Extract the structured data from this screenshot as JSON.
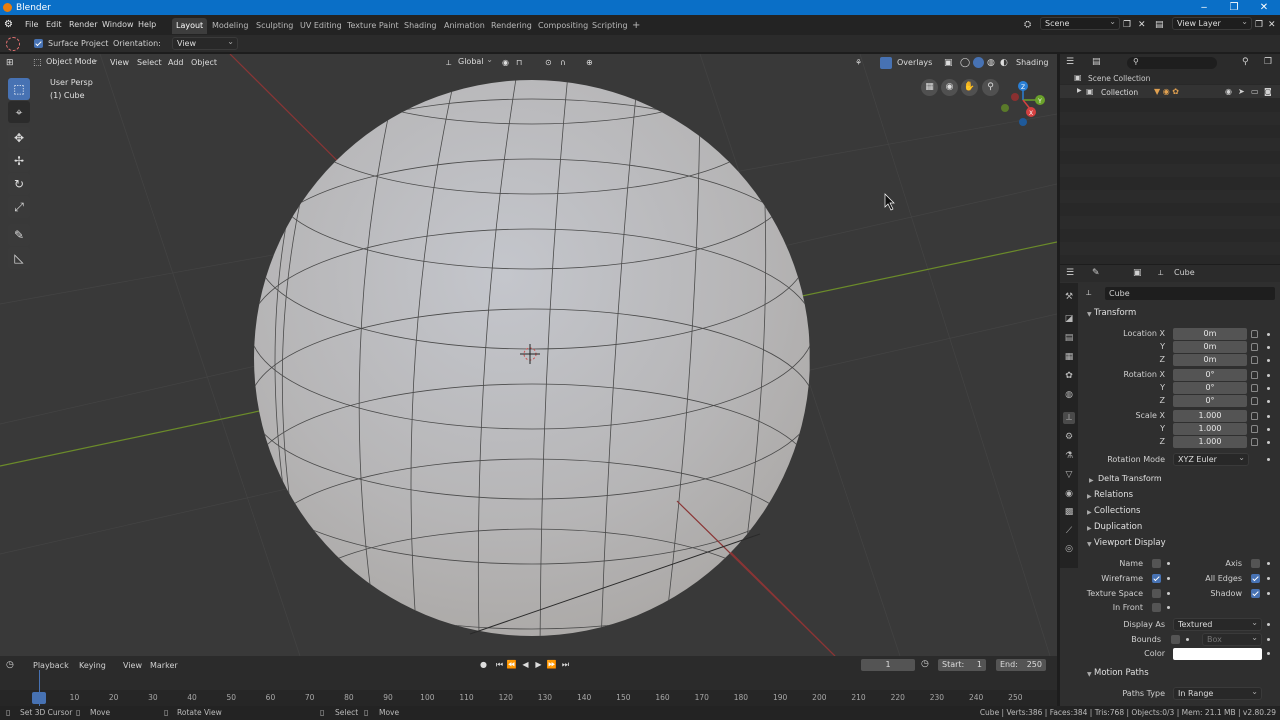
{
  "window": {
    "title": "Blender",
    "min": "‒",
    "restore": "❐",
    "close": "✕"
  },
  "menu": {
    "items": [
      "File",
      "Edit",
      "Render",
      "Window",
      "Help"
    ]
  },
  "workspaces": {
    "tabs": [
      "Layout",
      "Modeling",
      "Sculpting",
      "UV Editing",
      "Texture Paint",
      "Shading",
      "Animation",
      "Rendering",
      "Compositing",
      "Scripting"
    ],
    "active": "Layout",
    "add": "+"
  },
  "scene": {
    "name": "Scene",
    "view_layer": "View Layer"
  },
  "tool_header": {
    "surface_project": "Surface Project",
    "orientation_label": "Orientation:",
    "orientation_value": "View"
  },
  "viewport": {
    "mode": "Object Mode",
    "menus": [
      "View",
      "Select",
      "Add",
      "Object"
    ],
    "transform_orientation": "Global",
    "overlays": "Overlays",
    "shading": "Shading",
    "view_name": "User Persp",
    "object_name": "(1) Cube",
    "gizmo": {
      "x": "X",
      "y": "Y",
      "z": "Z"
    }
  },
  "outliner": {
    "search_placeholder": "",
    "scene_collection": "Scene Collection",
    "collection": "Collection"
  },
  "properties": {
    "object_name": "Cube",
    "header_name": "Cube",
    "transform": {
      "title": "Transform",
      "location": {
        "label_x": "Location X",
        "label_y": "Y",
        "label_z": "Z",
        "x": "0m",
        "y": "0m",
        "z": "0m"
      },
      "rotation": {
        "label_x": "Rotation X",
        "label_y": "Y",
        "label_z": "Z",
        "x": "0°",
        "y": "0°",
        "z": "0°"
      },
      "scale": {
        "label_x": "Scale X",
        "label_y": "Y",
        "label_z": "Z",
        "x": "1.000",
        "y": "1.000",
        "z": "1.000"
      },
      "rotation_mode_label": "Rotation Mode",
      "rotation_mode": "XYZ Euler"
    },
    "delta_transform": "Delta Transform",
    "relations": "Relations",
    "collections": "Collections",
    "duplication": "Duplication",
    "viewport_display": {
      "title": "Viewport Display",
      "name": "Name",
      "axis": "Axis",
      "wireframe": "Wireframe",
      "all_edges": "All Edges",
      "texture_space": "Texture Space",
      "shadow": "Shadow",
      "in_front": "In Front",
      "display_as_label": "Display As",
      "display_as": "Textured",
      "bounds_label": "Bounds",
      "bounds_value": "Box",
      "color_label": "Color",
      "color": "#ffffff"
    },
    "motion_paths": {
      "title": "Motion Paths",
      "paths_type_label": "Paths Type",
      "paths_type": "In Range"
    }
  },
  "timeline": {
    "menus": [
      "Playback",
      "Keying",
      "View",
      "Marker"
    ],
    "current_frame": "1",
    "start_label": "Start:",
    "start": "1",
    "end_label": "End:",
    "end": "250",
    "ruler": [
      "1",
      "10",
      "20",
      "30",
      "40",
      "50",
      "60",
      "70",
      "80",
      "90",
      "100",
      "110",
      "120",
      "130",
      "140",
      "150",
      "160",
      "170",
      "180",
      "190",
      "200",
      "210",
      "220",
      "230",
      "240",
      "250"
    ]
  },
  "statusbar": {
    "set_cursor": "Set 3D Cursor",
    "move": "Move",
    "rotate_view": "Rotate View",
    "select": "Select",
    "move2": "Move",
    "stats": "Cube | Verts:386 | Faces:384 | Tris:768 | Objects:0/3 | Mem: 21.1 MB | v2.80.29"
  },
  "colors": {
    "accent": "#4772b3",
    "titlebar": "#0a6fc7",
    "viewport_bg": "#393939"
  }
}
